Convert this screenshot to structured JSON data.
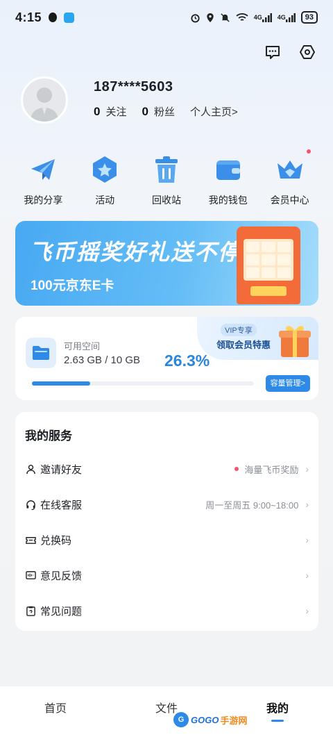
{
  "status_bar": {
    "time": "4:15",
    "battery": "93",
    "net1": "4G",
    "net2": "4G"
  },
  "header": {
    "message_icon": "message-icon",
    "settings_icon": "settings-icon"
  },
  "profile": {
    "phone": "187****5603",
    "following_count": "0",
    "following_label": "关注",
    "followers_count": "0",
    "followers_label": "粉丝",
    "homepage_link": "个人主页>"
  },
  "actions": [
    {
      "label": "我的分享",
      "icon": "paper-plane-icon"
    },
    {
      "label": "活动",
      "icon": "star-badge-icon"
    },
    {
      "label": "回收站",
      "icon": "trash-icon"
    },
    {
      "label": "我的钱包",
      "icon": "wallet-icon"
    },
    {
      "label": "会员中心",
      "icon": "crown-icon"
    }
  ],
  "banner": {
    "title": "飞币摇奖好礼送不停",
    "subtitle": "100元京东E卡"
  },
  "storage": {
    "available_label": "可用空间",
    "size_text": "2.63 GB / 10 GB",
    "percent_text": "26.3%",
    "percent_value": 26.3,
    "vip_tag": "VIP专享",
    "vip_offer": "领取会员特惠",
    "manage_button": "容量管理>"
  },
  "services": {
    "title": "我的服务",
    "items": [
      {
        "label": "邀请好友",
        "value": "海量飞币奖励",
        "icon": "person-icon",
        "has_dot": true
      },
      {
        "label": "在线客服",
        "value": "周一至周五 9:00~18:00",
        "icon": "headset-icon",
        "has_dot": false
      },
      {
        "label": "兑换码",
        "value": "",
        "icon": "ticket-icon",
        "has_dot": false
      },
      {
        "label": "意见反馈",
        "value": "",
        "icon": "feedback-icon",
        "has_dot": false
      },
      {
        "label": "常见问题",
        "value": "",
        "icon": "faq-icon",
        "has_dot": false
      }
    ]
  },
  "bottom_nav": {
    "tabs": [
      "首页",
      "文件",
      "我的"
    ],
    "active": "我的"
  },
  "watermark": {
    "text1": "GOGO",
    "text2": "手游网"
  },
  "colors": {
    "accent": "#2d8ae6",
    "dot": "#f2546b",
    "banner": "#48a9f2"
  }
}
